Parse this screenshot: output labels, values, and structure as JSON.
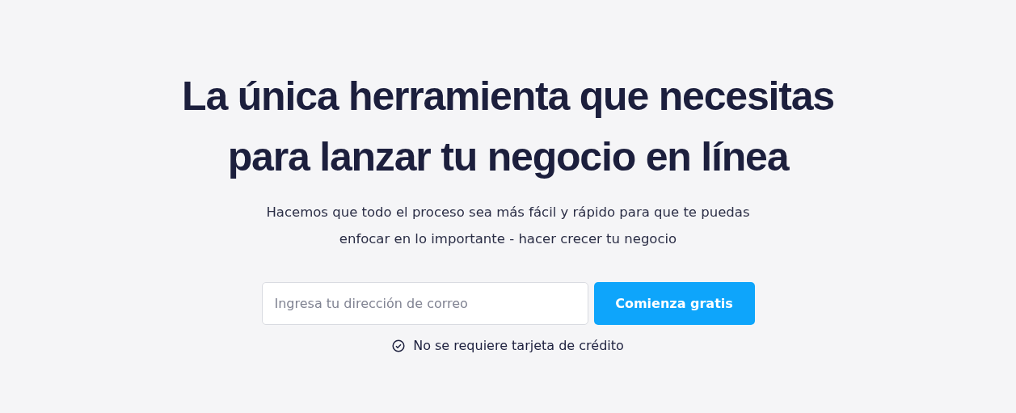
{
  "hero": {
    "title": "La única herramienta que necesitas para lanzar tu negocio en línea",
    "subtitle": "Hacemos que todo el proceso sea más fácil y rápido para que te puedas enfocar en lo importante - hacer crecer tu negocio"
  },
  "signup": {
    "email": {
      "placeholder": "Ingresa tu dirección de correo"
    },
    "button": "Comienza gratis"
  },
  "note": "No se requiere tarjeta de crédito"
}
